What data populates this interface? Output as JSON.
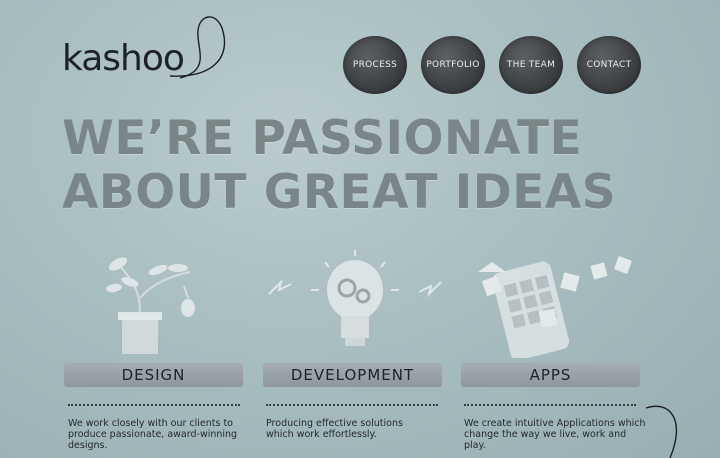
{
  "brand": {
    "logo_text": "kashoo"
  },
  "nav": {
    "items": [
      {
        "label": "PROCESS"
      },
      {
        "label": "PORTFOLIO"
      },
      {
        "label": "THE TEAM"
      },
      {
        "label": "CONTACT"
      }
    ]
  },
  "hero": {
    "line1": "WE’RE PASSIONATE",
    "line2": "ABOUT GREAT IDEAS"
  },
  "services": [
    {
      "title": "DESIGN",
      "description": "We work closely with our clients to produce passionate, award-winning designs.",
      "icon": "plant-illustration-icon"
    },
    {
      "title": "DEVELOPMENT",
      "description": "Producing effective solutions which work effortlessly.",
      "icon": "lightbulb-gears-icon"
    },
    {
      "title": "APPS",
      "description": "We create intuitive Applications which change the way we live, work and play.",
      "icon": "phone-apps-icon"
    }
  ]
}
